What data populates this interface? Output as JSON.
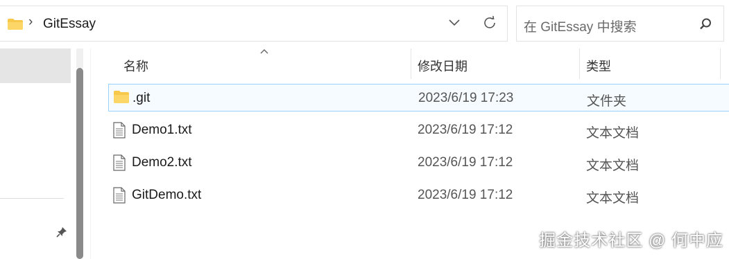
{
  "address_bar": {
    "breadcrumb": "GitEssay",
    "separator": "›"
  },
  "search": {
    "placeholder": "在 GitEssay 中搜索"
  },
  "columns": {
    "name": "名称",
    "date": "修改日期",
    "type": "类型"
  },
  "files": [
    {
      "name": ".git",
      "date": "2023/6/19 17:23",
      "type": "文件夹",
      "icon": "folder-icon",
      "selected": true
    },
    {
      "name": "Demo1.txt",
      "date": "2023/6/19 17:12",
      "type": "文本文档",
      "icon": "text-file-icon",
      "selected": false
    },
    {
      "name": "Demo2.txt",
      "date": "2023/6/19 17:12",
      "type": "文本文档",
      "icon": "text-file-icon",
      "selected": false
    },
    {
      "name": "GitDemo.txt",
      "date": "2023/6/19 17:12",
      "type": "文本文档",
      "icon": "text-file-icon",
      "selected": false
    }
  ],
  "watermark": "掘金技术社区 @ 何中应",
  "colors": {
    "selection_border": "#99d1ff",
    "folder_yellow": "#f8c84a"
  }
}
